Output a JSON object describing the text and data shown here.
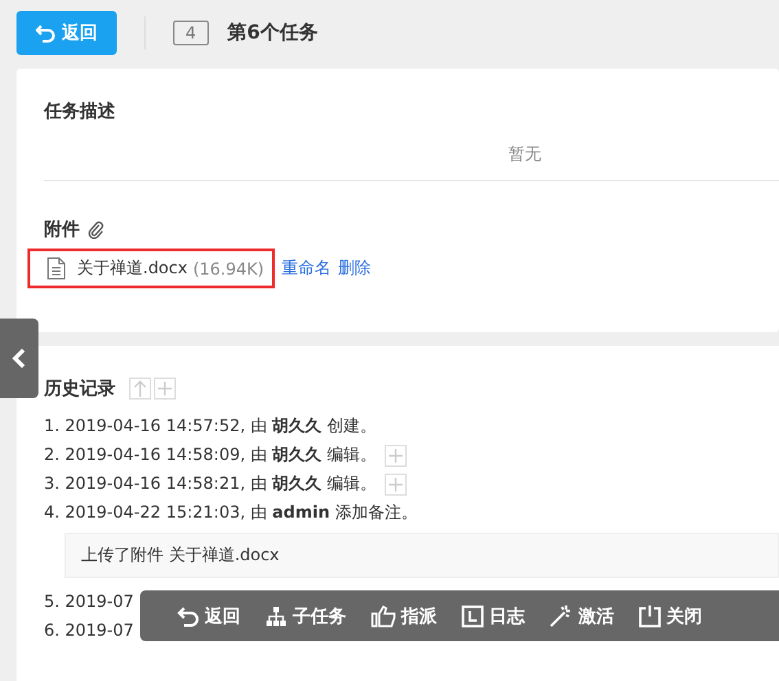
{
  "header": {
    "back_label": "返回",
    "id": "4",
    "title": "第6个任务"
  },
  "description": {
    "title": "任务描述",
    "empty_text": "暂无"
  },
  "attachments": {
    "title": "附件",
    "files": [
      {
        "name": "关于禅道.docx",
        "size": "(16.94K)",
        "highlighted": true,
        "actions": [
          "重命名",
          "删除"
        ]
      }
    ]
  },
  "history": {
    "title": "历史记录",
    "items": [
      {
        "text": "1. 2019-04-16 14:57:52, 由 **胡久久** 创建。",
        "expandable": false
      },
      {
        "text": "2. 2019-04-16 14:58:09, 由 **胡久久** 编辑。",
        "expandable": true
      },
      {
        "text": "3. 2019-04-16 14:58:21, 由 **胡久久** 编辑。",
        "expandable": true
      },
      {
        "text": "4. 2019-04-22 15:21:03, 由 **admin** 添加备注。",
        "expandable": false,
        "comment": "上传了附件 关于禅道.docx"
      },
      {
        "text": "5. 2019-07"
      },
      {
        "text": "6. 2019-07"
      }
    ]
  },
  "toolbar": [
    {
      "kind": "back",
      "label": "返回"
    },
    {
      "kind": "subtask",
      "label": "子任务"
    },
    {
      "kind": "assign",
      "label": "指派"
    },
    {
      "kind": "log",
      "label": "日志"
    },
    {
      "kind": "activate",
      "label": "激活"
    },
    {
      "kind": "close",
      "label": "关闭"
    }
  ]
}
